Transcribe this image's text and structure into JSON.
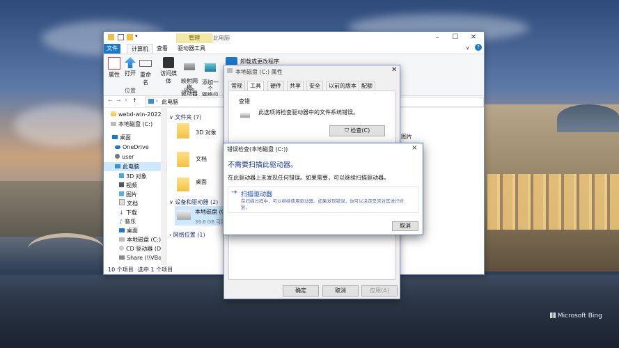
{
  "explorer": {
    "ribbon_context_tab": "管理",
    "window_title": "此电脑",
    "tabs": [
      "文件",
      "计算机",
      "查看",
      "驱动器工具"
    ],
    "ribbon_buttons": [
      {
        "label": "属性"
      },
      {
        "label": "打开"
      },
      {
        "label": "重命名"
      },
      {
        "label": "访问媒体"
      },
      {
        "label": "映射网络\n驱动器"
      },
      {
        "label": "添加一个\n网络位置"
      }
    ],
    "uninstall_label": "卸载或更改程序",
    "group_labels": [
      "位置",
      "网络"
    ],
    "address": "此电脑",
    "nav_items": [
      "webd-win-2022",
      "本地磁盘 (C:)",
      "桌面",
      "OneDrive",
      "user",
      "此电脑",
      "3D 对象",
      "视频",
      "图片",
      "文档",
      "下载",
      "音乐",
      "桌面",
      "本地磁盘 (C:)",
      "CD 驱动器 (D:)",
      "Share (\\\\VBox"
    ],
    "sections": {
      "folders": "文件夹 (7)",
      "devices": "设备和驱动器 (2)",
      "network": "网络位置 (1)"
    },
    "folders": [
      "3D 对象",
      "文档",
      "桌面"
    ],
    "right_label": "图片",
    "drive": {
      "name": "本地磁盘 (C:",
      "free": "39.6 GB 可用"
    },
    "status": {
      "count": "10 个项目",
      "selected": "选中 1 个项目"
    }
  },
  "props": {
    "title": "本地磁盘 (C:) 属性",
    "tabs": [
      "常规",
      "工具",
      "硬件",
      "共享",
      "安全",
      "以前的版本",
      "配额"
    ],
    "section_label": "查错",
    "section_text": "此选项将检查驱动器中的文件系统错误。",
    "check_button": "检查(C)",
    "ok": "确定",
    "cancel": "取消",
    "apply": "应用(A)"
  },
  "error_dialog": {
    "title": "错误检查(本地磁盘 (C:))",
    "close": "×",
    "heading": "不需要扫描此驱动器。",
    "text": "在此驱动器上未发现任何错误。如果需要，可以继续扫描驱动器。",
    "option_arrow": "→",
    "option_label": "扫描驱动器",
    "option_sub": "在扫描过程中，可以继续使用驱动器。如果发现错误，你可以决定是否对其进行修复。",
    "cancel": "取消"
  },
  "desktop": {
    "watermark": "Microsoft Bing"
  },
  "colors": {
    "accent": "#1979ca",
    "link": "#1a4bd6",
    "context_tab": "#f3e9a6"
  }
}
